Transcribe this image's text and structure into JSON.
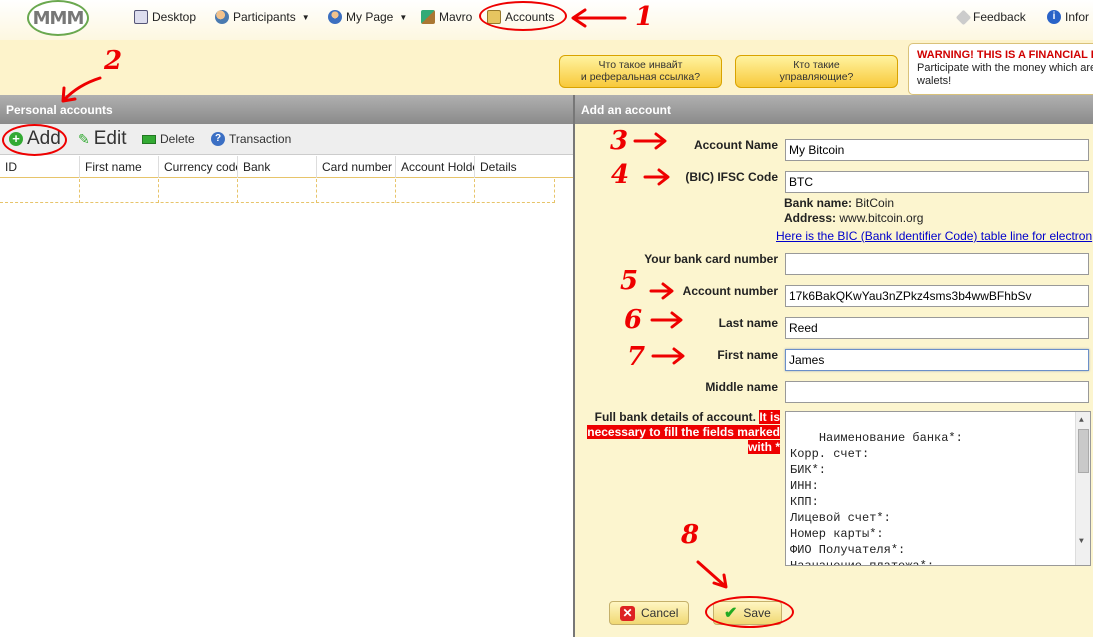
{
  "nav": {
    "logo": "MMM",
    "items": [
      {
        "label": "Desktop",
        "icon": "desktop-icon"
      },
      {
        "label": "Participants",
        "icon": "participants-icon",
        "dropdown": true
      },
      {
        "label": "My Page",
        "icon": "user-icon",
        "dropdown": true
      },
      {
        "label": "Mavro",
        "icon": "mavro-icon"
      },
      {
        "label": "Accounts",
        "icon": "accounts-icon"
      }
    ],
    "feedback": "Feedback",
    "info": "Infor"
  },
  "promos": [
    "Что такое инвайт\nи реферальная ссылка?",
    "Кто такие\nуправляющие?"
  ],
  "warning": {
    "title": "WARNING! THIS IS A FINANCIAL P",
    "line1": "Participate with the money which are",
    "line2": "walets!"
  },
  "left_panel": {
    "title": "Personal accounts",
    "toolbar": {
      "add": "Add",
      "edit": "Edit",
      "delete": "Delete",
      "transaction": "Transaction"
    },
    "columns": [
      "ID",
      "First name",
      "Currency code",
      "Bank",
      "Card number",
      "Account Holder",
      "Details"
    ]
  },
  "right_panel": {
    "title": "Add an account",
    "account_name_label": "Account Name",
    "account_name_value": "My Bitcoin",
    "bic_label": "(BIC) IFSC Code",
    "bic_value": "BTC",
    "bank_name_key": "Bank name:",
    "bank_name_value": "BitCoin",
    "address_key": "Address:",
    "address_value": "www.bitcoin.org",
    "bic_link": "Here is the BIC (Bank Identifier Code) table line for electron",
    "card_label": "Your bank card number",
    "card_value": "",
    "account_number_label": "Account number",
    "account_number_value": "17k6BakQKwYau3nZPkz4sms3b4wwBFhbSv",
    "last_name_label": "Last name",
    "last_name_value": "Reed",
    "first_name_label": "First name",
    "first_name_value": "James",
    "middle_name_label": "Middle name",
    "middle_name_value": "",
    "full_bank_label": "Full bank details of account.",
    "full_bank_note": "It is necessary to fill the fields marked with *",
    "details_text": "Наименование банка*:\nКорр. счет:\nБИК*:\nИНН:\nКПП:\nЛицевой счет*:\nНомер карты*:\nФИО Получателя*:\nНазначение платежа*:",
    "cancel": "Cancel",
    "save": "Save"
  },
  "annotations": [
    "1",
    "2",
    "3",
    "4",
    "5",
    "6",
    "7",
    "8"
  ],
  "colors": {
    "annotation": "#e00000",
    "accent": "#f8c93a",
    "link": "#0000cc"
  }
}
